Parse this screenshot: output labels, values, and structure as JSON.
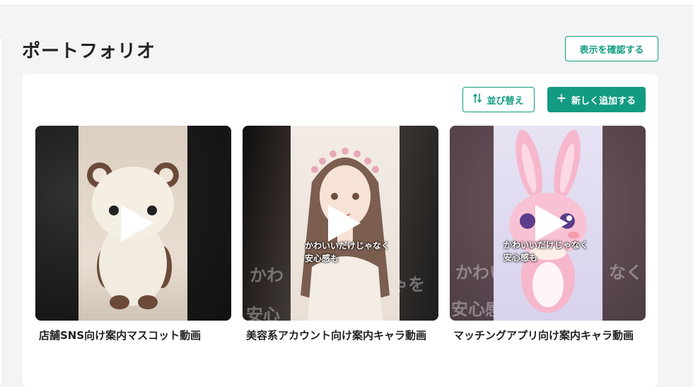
{
  "page": {
    "title": "ポートフォリオ",
    "confirm_button": "表示を確認する"
  },
  "toolbar": {
    "sort_label": "並び替え",
    "add_label": "新しく追加する"
  },
  "portfolio_items": [
    {
      "title": "店舗SNS向け案内マスコット動画",
      "overlay": ""
    },
    {
      "title": "美容系アカウント向け案内キャラ動画",
      "overlay_line1": "かわいいだけじゃなく",
      "overlay_line2": "安心感も"
    },
    {
      "title": "マッチングアプリ向け案内キャラ動画",
      "overlay_line1": "かわいいだけじゃなく",
      "overlay_line2": "安心感も"
    }
  ],
  "colors": {
    "accent": "#139b82"
  }
}
